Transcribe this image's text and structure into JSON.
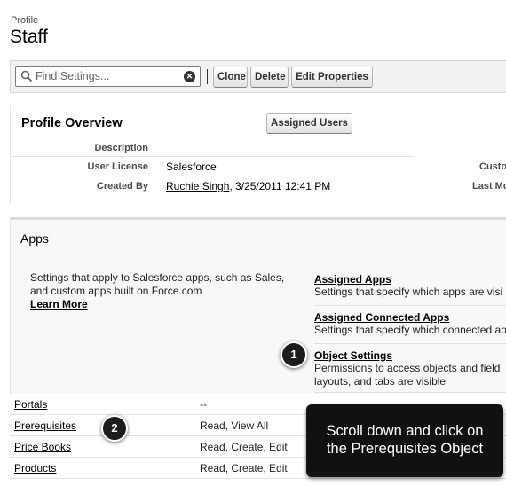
{
  "header": {
    "breadcrumb": "Profile",
    "title": "Staff"
  },
  "toolbar": {
    "search_placeholder": "Find Settings...",
    "clone_label": "Clone",
    "delete_label": "Delete",
    "edit_properties_label": "Edit Properties"
  },
  "overview": {
    "title": "Profile Overview",
    "assigned_users_label": "Assigned Users",
    "description_label": "Description",
    "user_license_label": "User License",
    "user_license_value": "Salesforce",
    "created_by_label": "Created By",
    "created_by_user": "Ruchie Singh",
    "created_by_date": ", 3/25/2011 12:41 PM",
    "right_label_1": "Custo",
    "right_label_2": "Last Mo"
  },
  "apps": {
    "title": "Apps",
    "description": "Settings that apply to Salesforce apps, such as Sales, and custom apps built on Force.com",
    "learn_more": "Learn More",
    "items": [
      {
        "label": "Assigned Apps",
        "desc": "Settings that specify which apps are visi"
      },
      {
        "label": "Assigned Connected Apps",
        "desc": "Settings that specify which connected ap"
      },
      {
        "label": "Object Settings",
        "desc": "Permissions to access objects and field",
        "desc2": "layouts, and tabs are visible"
      }
    ]
  },
  "objects": [
    {
      "name": "Portals",
      "perm": "--"
    },
    {
      "name": "Prerequisites",
      "perm": "Read, View All"
    },
    {
      "name": "Price Books",
      "perm": "Read, Create, Edit"
    },
    {
      "name": "Products",
      "perm": "Read, Create, Edit"
    }
  ],
  "markers": {
    "one": "1",
    "two": "2"
  },
  "callout": {
    "line1": "Scroll down and click on",
    "line2": "the Prerequisites Object"
  }
}
